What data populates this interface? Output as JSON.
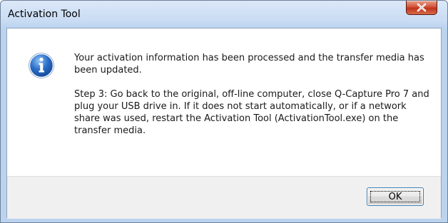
{
  "window": {
    "title": "Activation Tool"
  },
  "titlebar": {
    "close_icon": "close-icon"
  },
  "dialog": {
    "icon": "info-icon",
    "message_line1": "Your activation information has been processed and the transfer media has been updated.",
    "message_line2": "Step 3: Go back to the original, off-line computer, close Q-Capture Pro 7 and plug your USB drive in. If it does not start automatically, or if a network share was used, restart the Activation Tool (ActivationTool.exe) on the transfer media."
  },
  "buttons": {
    "ok_label": "OK"
  },
  "colors": {
    "close_button": "#c0331a",
    "info_icon": "#2a6dc7",
    "focus_border": "#3c7fb1"
  }
}
